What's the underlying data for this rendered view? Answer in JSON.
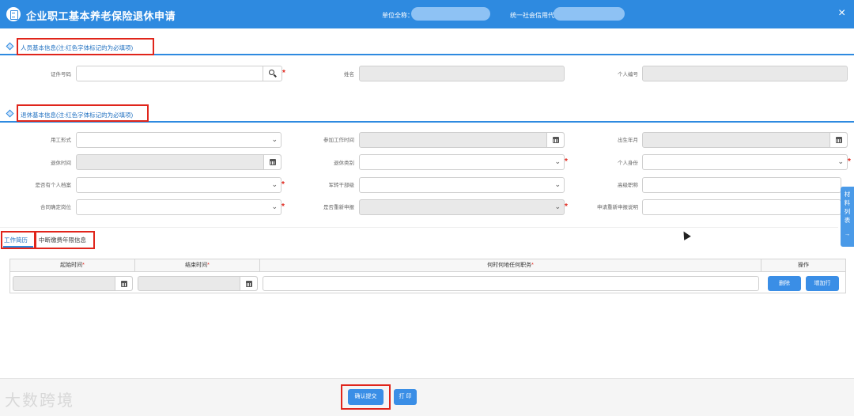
{
  "header": {
    "title": "企业职工基本养老保险退休申请",
    "unit_label": "单位全称：",
    "credit_label": "统一社会信用代码：",
    "close": "×"
  },
  "sections": {
    "personal": {
      "title": "人员基本信息(注:红色字体标记的为必填项)"
    },
    "retire": {
      "title": "退休基本信息(注:红色字体标记的为必填项)"
    }
  },
  "personal_fields": {
    "id_label": "证件号码",
    "name_label": "姓名",
    "person_no_label": "个人编号"
  },
  "retire_fields": {
    "employment_label": "用工形式",
    "work_start_label": "参加工作时间",
    "birth_label": "出生年月",
    "retire_time_label": "退休时间",
    "retire_type_label": "退休类别",
    "identity_label": "个人身份",
    "has_archive_label": "是否有个人档案",
    "military_label": "军转干部级",
    "title_label": "高级职称",
    "contract_label": "合同确定岗位",
    "reapply_label": "是否重新申报",
    "reapply_desc_label": "申请重新申报说明"
  },
  "tabs": [
    "工作简历",
    "中断缴费年限信息"
  ],
  "table": {
    "headers": [
      "起始时间",
      "结束时间",
      "何时何地任何职务",
      "操作"
    ],
    "delete_label": "删除",
    "add_label": "增加行"
  },
  "sidepanel": {
    "label": [
      "材",
      "料",
      "列",
      "表"
    ],
    "arrow": "→"
  },
  "footer": {
    "confirm_label": "确认提交",
    "print_label": "打 印",
    "watermark": "大数跨境"
  },
  "colors": {
    "primary": "#2e8ae0",
    "highlight": "#e0251b"
  },
  "icons": {
    "close": "close-icon",
    "search": "search-icon",
    "calendar": "calendar-icon",
    "chevron": "chevron-down-icon"
  }
}
